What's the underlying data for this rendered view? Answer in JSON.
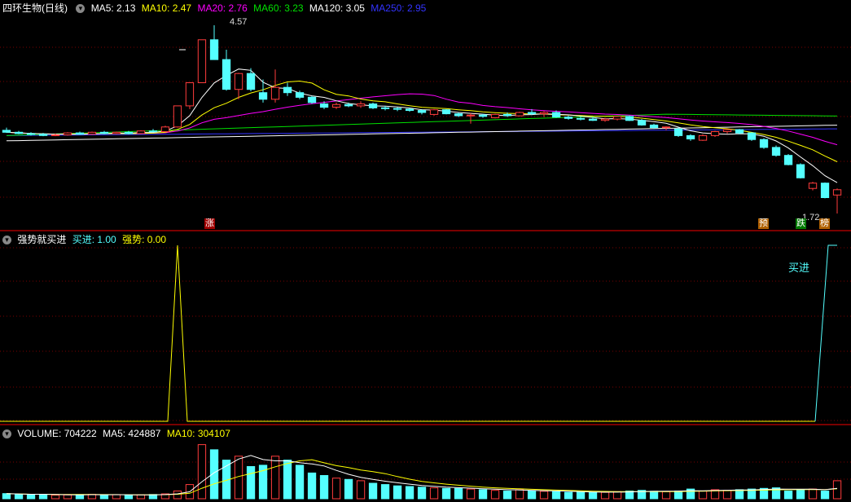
{
  "price_panel": {
    "title": "四环生物(日线)",
    "ma5": "MA5: 2.13",
    "ma10": "MA10: 2.47",
    "ma20": "MA20: 2.76",
    "ma60": "MA60: 3.23",
    "ma120": "MA120: 3.05",
    "ma250": "MA250: 2.95",
    "high_label": "4.57",
    "low_label": "1.72",
    "tags": {
      "zhang": "涨",
      "yu": "预",
      "die": "跌",
      "bang": "榜"
    }
  },
  "indicator_panel": {
    "title": "强势就买进",
    "buy": "买进: 1.00",
    "strong": "强势: 0.00",
    "buy_label": "买进"
  },
  "volume_panel": {
    "title": "VOLUME: 704222",
    "ma5": "MA5: 424887",
    "ma10": "MA10: 304107"
  },
  "colors": {
    "up": "#ff3c3c",
    "down": "#54ffff",
    "ma5": "#ffffff",
    "ma10": "#ffff00",
    "ma20": "#ff00ff",
    "ma60": "#00e000",
    "ma120": "#ffffff",
    "ma250": "#3333ff",
    "grid": "#7a0000"
  },
  "chart_data": {
    "type": "candlestick",
    "candles": [
      [
        2.98,
        3.02,
        2.94,
        2.95
      ],
      [
        2.95,
        2.97,
        2.92,
        2.93
      ],
      [
        2.93,
        2.95,
        2.9,
        2.92
      ],
      [
        2.92,
        2.94,
        2.89,
        2.9
      ],
      [
        2.9,
        2.93,
        2.89,
        2.91
      ],
      [
        2.91,
        2.95,
        2.9,
        2.94
      ],
      [
        2.94,
        2.96,
        2.91,
        2.92
      ],
      [
        2.92,
        2.96,
        2.91,
        2.95
      ],
      [
        2.95,
        2.97,
        2.92,
        2.93
      ],
      [
        2.93,
        2.96,
        2.92,
        2.95
      ],
      [
        2.95,
        2.97,
        2.92,
        2.93
      ],
      [
        2.93,
        2.98,
        2.92,
        2.97
      ],
      [
        2.97,
        3.0,
        2.95,
        2.96
      ],
      [
        2.96,
        3.05,
        2.95,
        3.03
      ],
      [
        3.03,
        3.35,
        3.02,
        3.35
      ],
      [
        3.35,
        3.7,
        3.3,
        3.7
      ],
      [
        3.7,
        4.35,
        3.7,
        4.35
      ],
      [
        4.35,
        4.57,
        4.05,
        4.05
      ],
      [
        4.05,
        4.2,
        3.58,
        3.6
      ],
      [
        3.6,
        3.85,
        3.45,
        3.84
      ],
      [
        3.84,
        3.92,
        3.57,
        3.6
      ],
      [
        3.55,
        3.75,
        3.4,
        3.45
      ],
      [
        3.45,
        3.9,
        3.4,
        3.63
      ],
      [
        3.63,
        3.7,
        3.5,
        3.55
      ],
      [
        3.55,
        3.58,
        3.45,
        3.48
      ],
      [
        3.48,
        3.5,
        3.38,
        3.4
      ],
      [
        3.38,
        3.42,
        3.3,
        3.33
      ],
      [
        3.33,
        3.4,
        3.3,
        3.37
      ],
      [
        3.37,
        3.4,
        3.33,
        3.35
      ],
      [
        3.35,
        3.42,
        3.32,
        3.38
      ],
      [
        3.38,
        3.4,
        3.3,
        3.32
      ],
      [
        3.32,
        3.35,
        3.28,
        3.31
      ],
      [
        3.31,
        3.33,
        3.27,
        3.3
      ],
      [
        3.3,
        3.32,
        3.26,
        3.28
      ],
      [
        3.28,
        3.3,
        3.22,
        3.25
      ],
      [
        3.22,
        3.3,
        3.2,
        3.29
      ],
      [
        3.29,
        3.3,
        3.22,
        3.23
      ],
      [
        3.23,
        3.25,
        3.18,
        3.2
      ],
      [
        3.2,
        3.24,
        3.08,
        3.21
      ],
      [
        3.21,
        3.23,
        3.17,
        3.19
      ],
      [
        3.17,
        3.23,
        3.16,
        3.22
      ],
      [
        3.22,
        3.25,
        3.18,
        3.2
      ],
      [
        3.2,
        3.26,
        3.19,
        3.25
      ],
      [
        3.25,
        3.3,
        3.21,
        3.23
      ],
      [
        3.23,
        3.27,
        3.18,
        3.25
      ],
      [
        3.25,
        3.28,
        3.17,
        3.18
      ],
      [
        3.18,
        3.2,
        3.14,
        3.16
      ],
      [
        3.16,
        3.18,
        3.13,
        3.15
      ],
      [
        3.15,
        3.18,
        3.12,
        3.13
      ],
      [
        3.13,
        3.17,
        3.11,
        3.15
      ],
      [
        3.15,
        3.2,
        3.13,
        3.19
      ],
      [
        3.19,
        3.2,
        3.12,
        3.13
      ],
      [
        3.13,
        3.15,
        3.05,
        3.06
      ],
      [
        3.06,
        3.08,
        3.0,
        3.02
      ],
      [
        3.02,
        3.04,
        2.98,
        3.03
      ],
      [
        3.0,
        3.02,
        2.88,
        2.9
      ],
      [
        2.9,
        2.92,
        2.82,
        2.85
      ],
      [
        2.83,
        2.92,
        2.82,
        2.9
      ],
      [
        2.9,
        2.97,
        2.88,
        2.96
      ],
      [
        2.96,
        3.0,
        2.93,
        2.99
      ],
      [
        2.99,
        3.0,
        2.92,
        2.94
      ],
      [
        2.94,
        2.95,
        2.82,
        2.84
      ],
      [
        2.84,
        2.86,
        2.7,
        2.72
      ],
      [
        2.72,
        2.75,
        2.58,
        2.6
      ],
      [
        2.6,
        2.62,
        2.45,
        2.46
      ],
      [
        2.46,
        2.48,
        2.25,
        2.26
      ],
      [
        2.1,
        2.2,
        2.07,
        2.18
      ],
      [
        2.18,
        2.19,
        1.95,
        1.96
      ],
      [
        2.0,
        2.1,
        1.72,
        2.08
      ]
    ]
  }
}
